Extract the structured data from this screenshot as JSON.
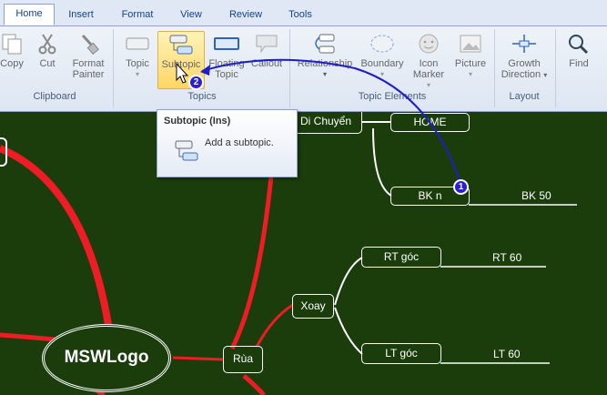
{
  "tabs": [
    "Home",
    "Insert",
    "Format",
    "View",
    "Review",
    "Tools"
  ],
  "clipboard": {
    "copy": "Copy",
    "cut": "Cut",
    "format_painter": "Format Painter",
    "group": "Clipboard"
  },
  "topics": {
    "topic": "Topic",
    "subtopic": "Subtopic",
    "floating": "Floating Topic",
    "callout": "Callout",
    "group": "Topics"
  },
  "elements": {
    "relationship": "Relationship",
    "boundary": "Boundary",
    "icon_marker": "Icon Marker",
    "picture": "Picture",
    "group": "Topic Elements"
  },
  "layout": {
    "growth": "Growth Direction",
    "group": "Layout"
  },
  "find": "Find",
  "tooltip": {
    "title": "Subtopic (Ins)",
    "description": "Add a subtopic."
  },
  "steps": [
    "1",
    "2"
  ],
  "map": {
    "central": "MSWLogo",
    "rua": "Rùa",
    "xoay": "Xoay",
    "di_chuyen": "Di Chuyển",
    "home": "HOME",
    "bkn": "BK n",
    "bk50": "BK 50",
    "rt_goc": "RT góc",
    "rt60": "RT 60",
    "lt_goc": "LT góc",
    "lt60": "LT 60"
  }
}
